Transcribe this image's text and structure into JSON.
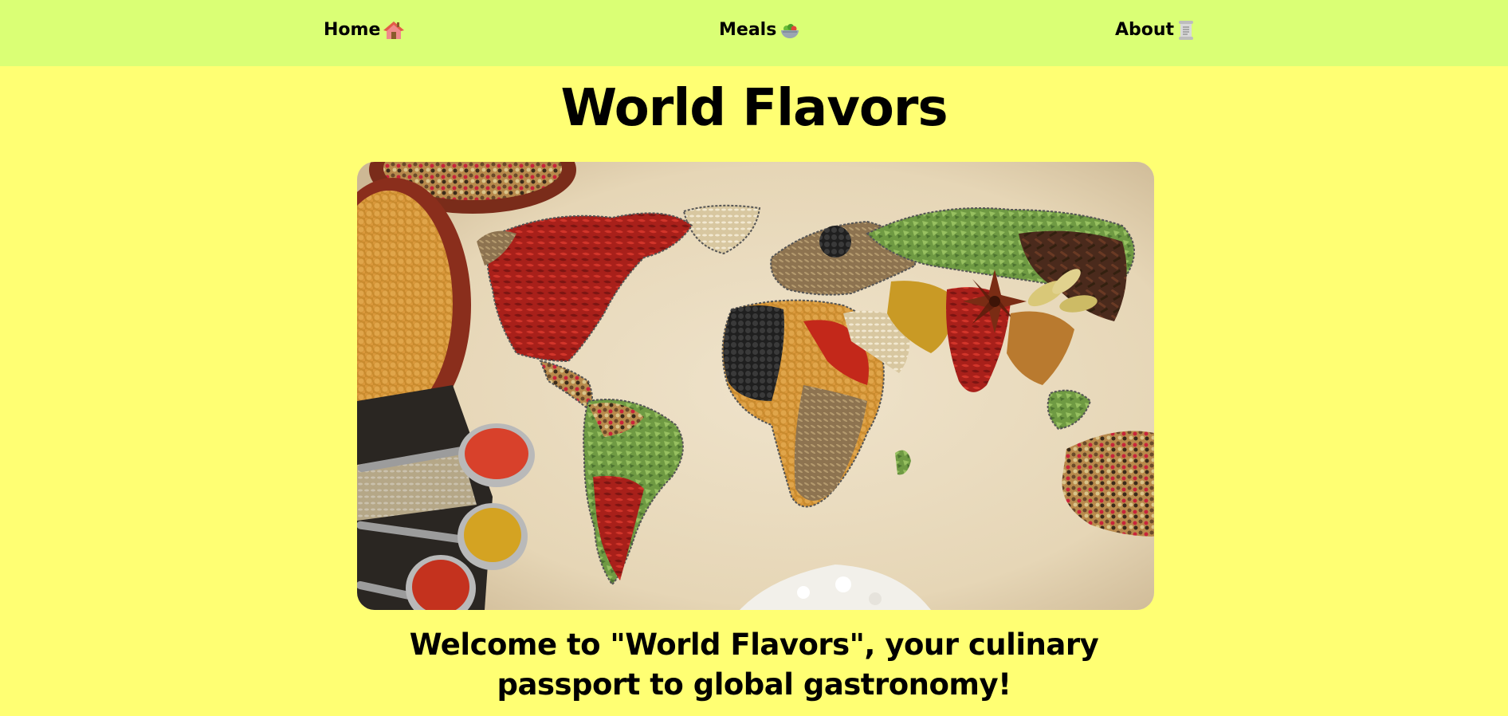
{
  "nav": {
    "home_label": "Home",
    "meals_label": "Meals",
    "about_label": "About",
    "home_icon": "house-emoji-icon",
    "meals_icon": "salad-bowl-emoji-icon",
    "about_icon": "scroll-emoji-icon"
  },
  "page": {
    "title": "World Flavors",
    "welcome": "Welcome to \"World Flavors\", your culinary passport to global gastronomy!"
  },
  "hero": {
    "image_alt": "world map made of spices"
  },
  "colors": {
    "background": "#ffff73",
    "nav_background": "#daff75"
  }
}
